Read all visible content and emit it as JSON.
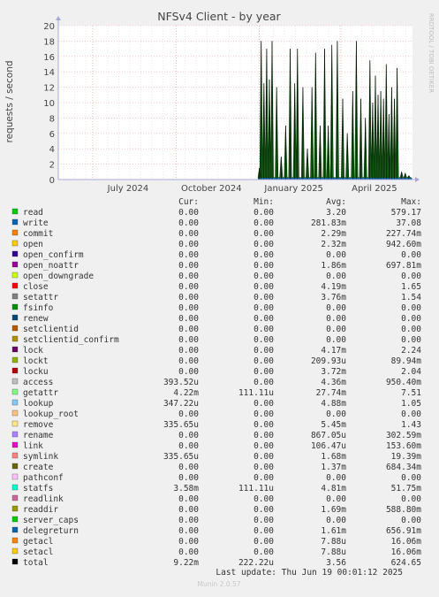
{
  "chart_data": {
    "type": "line",
    "title": "NFSv4 Client - by year",
    "ylabel": "requests / second",
    "watermark": "RRDTOOL / TOBI OETIKER",
    "ylim": [
      0,
      20
    ],
    "yticks": [
      0,
      2,
      4,
      6,
      8,
      10,
      12,
      14,
      16,
      18,
      20
    ],
    "x_tick_labels": [
      "July 2024",
      "October 2024",
      "January 2025",
      "April 2025"
    ],
    "grid": true,
    "x_range": [
      "2024-05",
      "2025-06-19"
    ],
    "data_start": "2024-12-31",
    "series": [
      {
        "name": "total",
        "peaks": [
          {
            "date": "2025-01-01",
            "value": 1.5
          },
          {
            "date": "2025-01-03",
            "value": 18.0
          },
          {
            "date": "2025-01-06",
            "value": 12.5
          },
          {
            "date": "2025-01-09",
            "value": 17.0
          },
          {
            "date": "2025-01-12",
            "value": 13.0
          },
          {
            "date": "2025-01-15",
            "value": 18.0
          },
          {
            "date": "2025-01-20",
            "value": 12.0
          },
          {
            "date": "2025-01-25",
            "value": 3.0
          },
          {
            "date": "2025-01-30",
            "value": 7.0
          },
          {
            "date": "2025-02-04",
            "value": 17.0
          },
          {
            "date": "2025-02-09",
            "value": 12.5
          },
          {
            "date": "2025-02-12",
            "value": 17.0
          },
          {
            "date": "2025-02-18",
            "value": 12.0
          },
          {
            "date": "2025-02-23",
            "value": 4.0
          },
          {
            "date": "2025-02-28",
            "value": 12.0
          },
          {
            "date": "2025-03-04",
            "value": 16.5
          },
          {
            "date": "2025-03-09",
            "value": 7.0
          },
          {
            "date": "2025-03-14",
            "value": 17.0
          },
          {
            "date": "2025-03-18",
            "value": 7.0
          },
          {
            "date": "2025-03-22",
            "value": 17.5
          },
          {
            "date": "2025-03-28",
            "value": 18.0
          },
          {
            "date": "2025-04-03",
            "value": 10.5
          },
          {
            "date": "2025-04-08",
            "value": 6.0
          },
          {
            "date": "2025-04-14",
            "value": 11.5
          },
          {
            "date": "2025-04-18",
            "value": 18.0
          },
          {
            "date": "2025-04-23",
            "value": 10.5
          },
          {
            "date": "2025-04-28",
            "value": 8.0
          },
          {
            "date": "2025-05-03",
            "value": 15.5
          },
          {
            "date": "2025-05-06",
            "value": 10.0
          },
          {
            "date": "2025-05-09",
            "value": 13.5
          },
          {
            "date": "2025-05-12",
            "value": 11.0
          },
          {
            "date": "2025-05-15",
            "value": 11.5
          },
          {
            "date": "2025-05-18",
            "value": 10.5
          },
          {
            "date": "2025-05-21",
            "value": 15.0
          },
          {
            "date": "2025-05-24",
            "value": 8.5
          },
          {
            "date": "2025-05-27",
            "value": 12.0
          },
          {
            "date": "2025-05-30",
            "value": 10.5
          },
          {
            "date": "2025-06-02",
            "value": 14.5
          },
          {
            "date": "2025-06-07",
            "value": 1.0
          },
          {
            "date": "2025-06-11",
            "value": 0.8
          },
          {
            "date": "2025-06-15",
            "value": 0.5
          }
        ]
      }
    ],
    "legend_headers": [
      "Cur:",
      "Min:",
      "Avg:",
      "Max:"
    ],
    "legend": [
      {
        "name": "read",
        "color": "#00cc00",
        "cur": "0.00",
        "min": "0.00",
        "avg": "3.20",
        "max": "579.17"
      },
      {
        "name": "write",
        "color": "#0066b3",
        "cur": "0.00",
        "min": "0.00",
        "avg": "281.83m",
        "max": "37.08"
      },
      {
        "name": "commit",
        "color": "#ff8000",
        "cur": "0.00",
        "min": "0.00",
        "avg": "2.29m",
        "max": "227.74m"
      },
      {
        "name": "open",
        "color": "#ffcc00",
        "cur": "0.00",
        "min": "0.00",
        "avg": "2.32m",
        "max": "942.60m"
      },
      {
        "name": "open_confirm",
        "color": "#330099",
        "cur": "0.00",
        "min": "0.00",
        "avg": "0.00",
        "max": "0.00"
      },
      {
        "name": "open_noattr",
        "color": "#990099",
        "cur": "0.00",
        "min": "0.00",
        "avg": "1.86m",
        "max": "697.81m"
      },
      {
        "name": "open_downgrade",
        "color": "#ccff00",
        "cur": "0.00",
        "min": "0.00",
        "avg": "0.00",
        "max": "0.00"
      },
      {
        "name": "close",
        "color": "#ff0000",
        "cur": "0.00",
        "min": "0.00",
        "avg": "4.19m",
        "max": "1.65"
      },
      {
        "name": "setattr",
        "color": "#808080",
        "cur": "0.00",
        "min": "0.00",
        "avg": "3.76m",
        "max": "1.54"
      },
      {
        "name": "fsinfo",
        "color": "#008f00",
        "cur": "0.00",
        "min": "0.00",
        "avg": "0.00",
        "max": "0.00"
      },
      {
        "name": "renew",
        "color": "#00487d",
        "cur": "0.00",
        "min": "0.00",
        "avg": "0.00",
        "max": "0.00"
      },
      {
        "name": "setclientid",
        "color": "#b35a00",
        "cur": "0.00",
        "min": "0.00",
        "avg": "0.00",
        "max": "0.00"
      },
      {
        "name": "setclientid_confirm",
        "color": "#b38f00",
        "cur": "0.00",
        "min": "0.00",
        "avg": "0.00",
        "max": "0.00"
      },
      {
        "name": "lock",
        "color": "#6b006b",
        "cur": "0.00",
        "min": "0.00",
        "avg": "4.17m",
        "max": "2.24"
      },
      {
        "name": "lockt",
        "color": "#8fb300",
        "cur": "0.00",
        "min": "0.00",
        "avg": "209.93u",
        "max": "89.94m"
      },
      {
        "name": "locku",
        "color": "#b30000",
        "cur": "0.00",
        "min": "0.00",
        "avg": "3.72m",
        "max": "2.04"
      },
      {
        "name": "access",
        "color": "#bebebe",
        "cur": "393.52u",
        "min": "0.00",
        "avg": "4.36m",
        "max": "950.40m"
      },
      {
        "name": "getattr",
        "color": "#80ff80",
        "cur": "4.22m",
        "min": "111.11u",
        "avg": "27.74m",
        "max": "7.51"
      },
      {
        "name": "lookup",
        "color": "#80c9ff",
        "cur": "347.22u",
        "min": "0.00",
        "avg": "4.88m",
        "max": "1.05"
      },
      {
        "name": "lookup_root",
        "color": "#ffc080",
        "cur": "0.00",
        "min": "0.00",
        "avg": "0.00",
        "max": "0.00"
      },
      {
        "name": "remove",
        "color": "#ffe680",
        "cur": "335.65u",
        "min": "0.00",
        "avg": "5.45m",
        "max": "1.43"
      },
      {
        "name": "rename",
        "color": "#aa80ff",
        "cur": "0.00",
        "min": "0.00",
        "avg": "867.05u",
        "max": "302.59m"
      },
      {
        "name": "link",
        "color": "#ee00cc",
        "cur": "0.00",
        "min": "0.00",
        "avg": "106.47u",
        "max": "153.60m"
      },
      {
        "name": "symlink",
        "color": "#ff8080",
        "cur": "335.65u",
        "min": "0.00",
        "avg": "1.68m",
        "max": "19.39m"
      },
      {
        "name": "create",
        "color": "#666600",
        "cur": "0.00",
        "min": "0.00",
        "avg": "1.37m",
        "max": "684.34m"
      },
      {
        "name": "pathconf",
        "color": "#ffbfff",
        "cur": "0.00",
        "min": "0.00",
        "avg": "0.00",
        "max": "0.00"
      },
      {
        "name": "statfs",
        "color": "#00ffcc",
        "cur": "3.58m",
        "min": "111.11u",
        "avg": "4.81m",
        "max": "51.75m"
      },
      {
        "name": "readlink",
        "color": "#cc6699",
        "cur": "0.00",
        "min": "0.00",
        "avg": "0.00",
        "max": "0.00"
      },
      {
        "name": "readdir",
        "color": "#999900",
        "cur": "0.00",
        "min": "0.00",
        "avg": "1.69m",
        "max": "588.80m"
      },
      {
        "name": "server_caps",
        "color": "#00cc00",
        "cur": "0.00",
        "min": "0.00",
        "avg": "0.00",
        "max": "0.00"
      },
      {
        "name": "delegreturn",
        "color": "#0066b3",
        "cur": "0.00",
        "min": "0.00",
        "avg": "1.61m",
        "max": "656.91m"
      },
      {
        "name": "getacl",
        "color": "#ff8000",
        "cur": "0.00",
        "min": "0.00",
        "avg": "7.88u",
        "max": "16.06m"
      },
      {
        "name": "setacl",
        "color": "#ffcc00",
        "cur": "0.00",
        "min": "0.00",
        "avg": "7.88u",
        "max": "16.06m"
      },
      {
        "name": "total",
        "color": "#000000",
        "cur": "9.22m",
        "min": "222.22u",
        "avg": "3.56",
        "max": "624.65"
      }
    ],
    "last_update": "Last update: Thu Jun 19 00:01:12 2025",
    "footer": "Munin 2.0.57"
  }
}
